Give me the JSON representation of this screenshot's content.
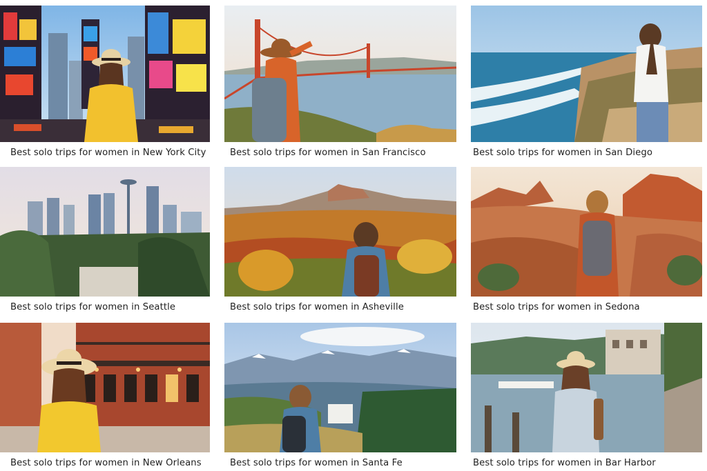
{
  "cards": [
    {
      "caption": "Best solo trips for women in New York City",
      "scene": "new-york"
    },
    {
      "caption": "Best solo trips for women in San Francisco",
      "scene": "san-francisco"
    },
    {
      "caption": "Best solo trips for women in San Diego",
      "scene": "san-diego"
    },
    {
      "caption": "Best solo trips for women in Seattle",
      "scene": "seattle"
    },
    {
      "caption": "Best solo trips for women in Asheville",
      "scene": "asheville"
    },
    {
      "caption": "Best solo trips for women in Sedona",
      "scene": "sedona"
    },
    {
      "caption": "Best solo trips for women in New Orleans",
      "scene": "new-orleans"
    },
    {
      "caption": "Best solo trips for women in Santa Fe",
      "scene": "santa-fe"
    },
    {
      "caption": "Best solo trips for women in Bar Harbor",
      "scene": "bar-harbor"
    }
  ]
}
